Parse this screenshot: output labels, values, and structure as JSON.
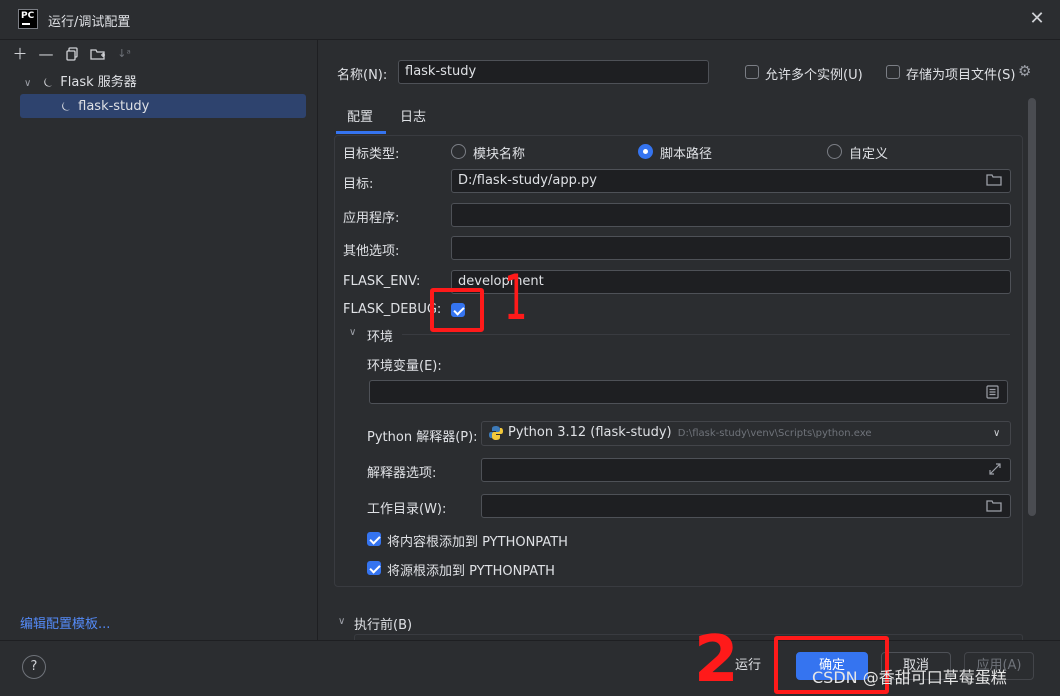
{
  "window": {
    "title": "运行/调试配置",
    "app_icon": "PC"
  },
  "toolbar": {
    "icons": [
      "plus-icon",
      "minus-icon",
      "copy-icon",
      "folder-add-icon",
      "sort-icon"
    ]
  },
  "tree": {
    "group_label": "Flask 服务器",
    "item_label": "flask-study"
  },
  "left_footer": {
    "edit_templates": "编辑配置模板..."
  },
  "header": {
    "name_label": "名称(N):",
    "name_value": "flask-study",
    "allow_multiple": "允许多个实例(U)",
    "store_as_file": "存储为项目文件(S)"
  },
  "tabs": [
    {
      "label": "配置"
    },
    {
      "label": "日志"
    }
  ],
  "config": {
    "target_type_label": "目标类型:",
    "target_type_options": [
      "模块名称",
      "脚本路径",
      "自定义"
    ],
    "target_type_selected": "脚本路径",
    "target_label": "目标:",
    "target_value": "D:/flask-study/app.py",
    "app_label": "应用程序:",
    "app_value": "",
    "other_label": "其他选项:",
    "other_value": "",
    "flask_env_label": "FLASK_ENV:",
    "flask_env_value": "development",
    "flask_debug_label": "FLASK_DEBUG:",
    "flask_debug_checked": true,
    "env_section": "环境",
    "env_vars_label": "环境变量(E):",
    "env_vars_value": "",
    "interpreter_label": "Python 解释器(P):",
    "interpreter_name": "Python 3.12 (flask-study)",
    "interpreter_path": "D:\\flask-study\\venv\\Scripts\\python.exe",
    "interp_options_label": "解释器选项:",
    "interp_options_value": "",
    "workdir_label": "工作目录(W):",
    "workdir_value": "",
    "add_content_roots": "将内容根添加到 PYTHONPATH",
    "add_source_roots": "将源根添加到 PYTHONPATH",
    "before_launch": "执行前(B)"
  },
  "buttons": {
    "help": "?",
    "run": "运行",
    "ok": "确定",
    "cancel": "取消",
    "apply": "应用(A)"
  },
  "annotations": {
    "one": "1",
    "two": "2"
  },
  "watermark": "CSDN @香甜可口草莓蛋糕",
  "colors": {
    "accent": "#3574f0",
    "annotation": "#ff1a1a",
    "link": "#548af7"
  }
}
